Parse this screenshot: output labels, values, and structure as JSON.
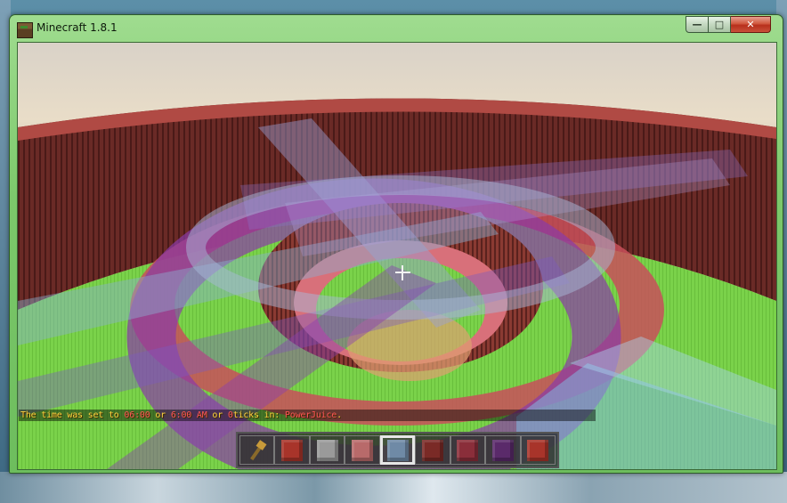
{
  "window": {
    "title": "Minecraft 1.8.1",
    "minimize_glyph": "—",
    "maximize_glyph": "□",
    "close_glyph": "✕"
  },
  "chat": {
    "segments": [
      {
        "text": "The time was set to ",
        "color": "#ffd23f"
      },
      {
        "text": "06:00",
        "color": "#ff5555"
      },
      {
        "text": " or ",
        "color": "#ffd23f"
      },
      {
        "text": "6:00 AM",
        "color": "#ff5555"
      },
      {
        "text": " or ",
        "color": "#ffd23f"
      },
      {
        "text": "0",
        "color": "#ff5555"
      },
      {
        "text": "ticks in: ",
        "color": "#ffd23f"
      },
      {
        "text": "PowerJuice",
        "color": "#ff5555"
      },
      {
        "text": ".",
        "color": "#ffd23f"
      }
    ]
  },
  "hotbar": {
    "selected_index": 4,
    "slots": [
      {
        "item": "golden-axe",
        "color": "#c89a3a"
      },
      {
        "item": "red-block",
        "color": "#a8342a"
      },
      {
        "item": "gray-block",
        "color": "#9a9a9a"
      },
      {
        "item": "pink-block",
        "color": "#b86a6a"
      },
      {
        "item": "light-blue-block",
        "color": "#6f8aa6"
      },
      {
        "item": "dark-red-block",
        "color": "#7a2a26"
      },
      {
        "item": "crimson-block",
        "color": "#8a2e3a"
      },
      {
        "item": "purple-block",
        "color": "#5a2a6a"
      },
      {
        "item": "red-block",
        "color": "#a8342a"
      }
    ]
  },
  "icons": {
    "app": "minecraft-grass-block-icon",
    "crosshair": "crosshair-icon"
  }
}
